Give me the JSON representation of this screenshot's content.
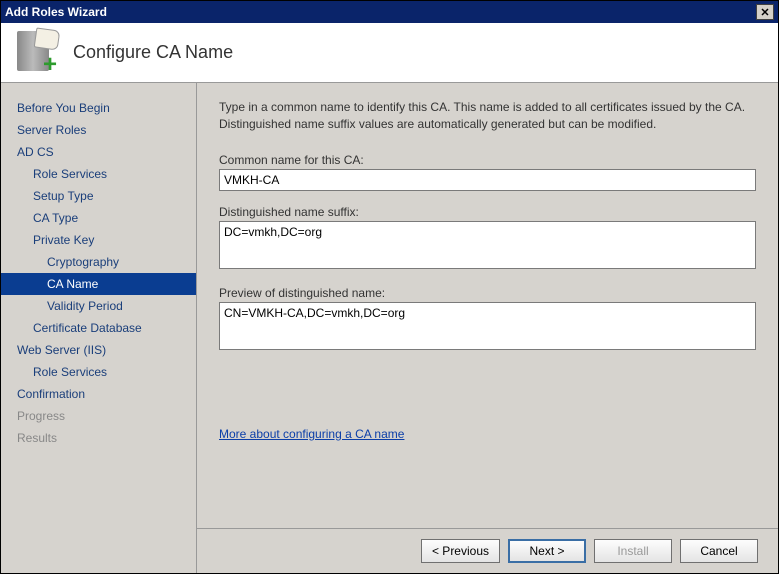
{
  "window": {
    "title": "Add Roles Wizard"
  },
  "header": {
    "title": "Configure CA Name"
  },
  "sidebar": {
    "items": [
      {
        "label": "Before You Begin",
        "indent": 0
      },
      {
        "label": "Server Roles",
        "indent": 0
      },
      {
        "label": "AD CS",
        "indent": 0
      },
      {
        "label": "Role Services",
        "indent": 1
      },
      {
        "label": "Setup Type",
        "indent": 1
      },
      {
        "label": "CA Type",
        "indent": 1
      },
      {
        "label": "Private Key",
        "indent": 1
      },
      {
        "label": "Cryptography",
        "indent": 2
      },
      {
        "label": "CA Name",
        "indent": 2,
        "selected": true
      },
      {
        "label": "Validity Period",
        "indent": 2
      },
      {
        "label": "Certificate Database",
        "indent": 1
      },
      {
        "label": "Web Server (IIS)",
        "indent": 0
      },
      {
        "label": "Role Services",
        "indent": 1
      },
      {
        "label": "Confirmation",
        "indent": 0
      },
      {
        "label": "Progress",
        "indent": 0,
        "disabled": true
      },
      {
        "label": "Results",
        "indent": 0,
        "disabled": true
      }
    ]
  },
  "content": {
    "intro": "Type in a common name to identify this CA. This name is added to all certificates issued by the CA. Distinguished name suffix values are automatically generated but can be modified.",
    "common_name_label": "Common name for this CA:",
    "common_name_value": "VMKH-CA",
    "dn_suffix_label": "Distinguished name suffix:",
    "dn_suffix_value": "DC=vmkh,DC=org",
    "preview_label": "Preview of distinguished name:",
    "preview_value": "CN=VMKH-CA,DC=vmkh,DC=org",
    "link_text": "More about configuring a CA name"
  },
  "footer": {
    "previous": "< Previous",
    "next": "Next >",
    "install": "Install",
    "cancel": "Cancel"
  }
}
